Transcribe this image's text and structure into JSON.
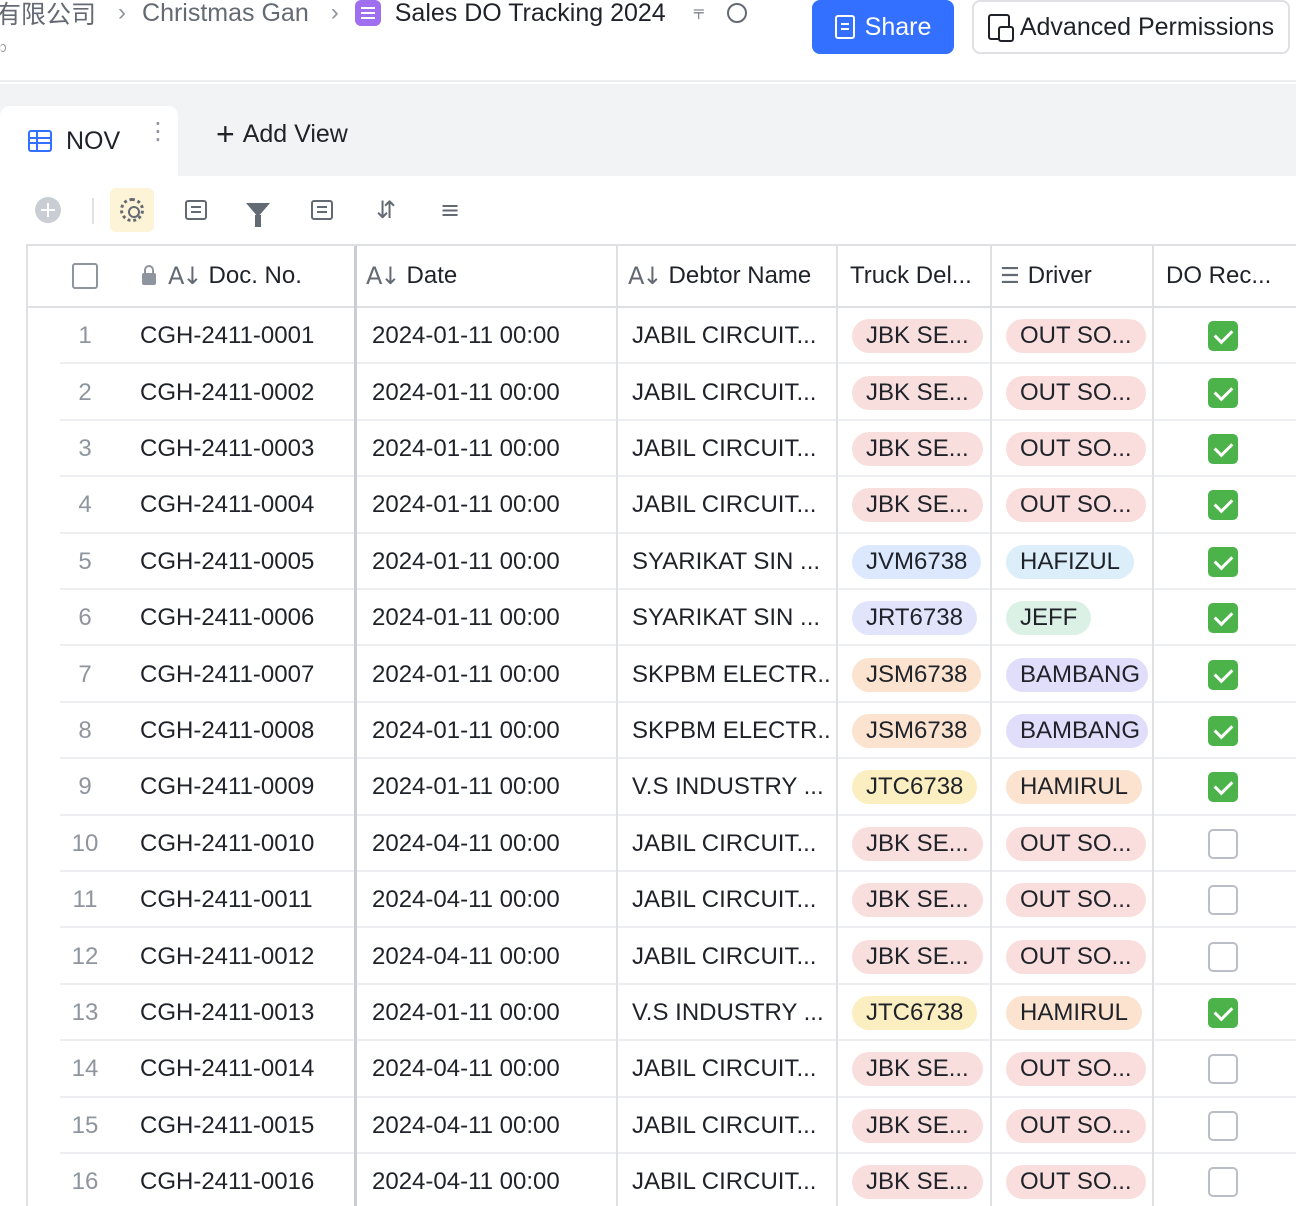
{
  "breadcrumb": {
    "org": "有限公司",
    "workspace": "Christmas Gan",
    "document": "Sales DO Tracking 2024"
  },
  "header": {
    "share_label": "Share",
    "permissions_label": "Advanced Permissions"
  },
  "tabs": {
    "active_label": "NOV",
    "add_view_label": "Add View"
  },
  "colors": {
    "accent": "#3370ff",
    "check_on": "#4cb24a",
    "tag_jbk": "#f9dede",
    "tag_out": "#fadede",
    "tag_blue": "#dbe8fd",
    "tag_green": "#dcf1e6",
    "tag_orange": "#fbe3d0",
    "tag_yellow": "#fbeec0",
    "tag_purple": "#e1defb",
    "tag_hamirul": "#fbe3d0"
  },
  "table": {
    "columns": {
      "doc_no": "Doc. No.",
      "date": "Date",
      "debtor": "Debtor Name",
      "truck": "Truck Del...",
      "driver": "Driver",
      "do_rec": "DO Rec..."
    },
    "rows": [
      {
        "n": "1",
        "doc": "CGH-2411-0001",
        "date": "2024-01-11 00:00",
        "debtor": "JABIL CIRCUIT...",
        "truck": "JBK SE...",
        "truck_color": "#f9dede",
        "driver": "OUT SO...",
        "driver_color": "#fadede",
        "checked": true
      },
      {
        "n": "2",
        "doc": "CGH-2411-0002",
        "date": "2024-01-11 00:00",
        "debtor": "JABIL CIRCUIT...",
        "truck": "JBK SE...",
        "truck_color": "#f9dede",
        "driver": "OUT SO...",
        "driver_color": "#fadede",
        "checked": true
      },
      {
        "n": "3",
        "doc": "CGH-2411-0003",
        "date": "2024-01-11 00:00",
        "debtor": "JABIL CIRCUIT...",
        "truck": "JBK SE...",
        "truck_color": "#f9dede",
        "driver": "OUT SO...",
        "driver_color": "#fadede",
        "checked": true
      },
      {
        "n": "4",
        "doc": "CGH-2411-0004",
        "date": "2024-01-11 00:00",
        "debtor": "JABIL CIRCUIT...",
        "truck": "JBK SE...",
        "truck_color": "#f9dede",
        "driver": "OUT SO...",
        "driver_color": "#fadede",
        "checked": true
      },
      {
        "n": "5",
        "doc": "CGH-2411-0005",
        "date": "2024-01-11 00:00",
        "debtor": "SYARIKAT SIN ...",
        "truck": "JVM6738",
        "truck_color": "#dbe8fd",
        "driver": "HAFIZUL",
        "driver_color": "#dbeefa",
        "checked": true
      },
      {
        "n": "6",
        "doc": "CGH-2411-0006",
        "date": "2024-01-11 00:00",
        "debtor": "SYARIKAT SIN ...",
        "truck": "JRT6738",
        "truck_color": "#e1e4fb",
        "driver": "JEFF",
        "driver_color": "#dcf1e6",
        "checked": true
      },
      {
        "n": "7",
        "doc": "CGH-2411-0007",
        "date": "2024-01-11 00:00",
        "debtor": "SKPBM ELECTR...",
        "truck": "JSM6738",
        "truck_color": "#fbe3d0",
        "driver": "BAMBANG",
        "driver_color": "#e1defb",
        "checked": true
      },
      {
        "n": "8",
        "doc": "CGH-2411-0008",
        "date": "2024-01-11 00:00",
        "debtor": "SKPBM ELECTR...",
        "truck": "JSM6738",
        "truck_color": "#fbe3d0",
        "driver": "BAMBANG",
        "driver_color": "#e1defb",
        "checked": true
      },
      {
        "n": "9",
        "doc": "CGH-2411-0009",
        "date": "2024-01-11 00:00",
        "debtor": "V.S INDUSTRY ...",
        "truck": "JTC6738",
        "truck_color": "#fbeec0",
        "driver": "HAMIRUL",
        "driver_color": "#fbe3d0",
        "checked": true
      },
      {
        "n": "10",
        "doc": "CGH-2411-0010",
        "date": "2024-04-11 00:00",
        "debtor": "JABIL CIRCUIT...",
        "truck": "JBK SE...",
        "truck_color": "#f9dede",
        "driver": "OUT SO...",
        "driver_color": "#fadede",
        "checked": false
      },
      {
        "n": "11",
        "doc": "CGH-2411-0011",
        "date": "2024-04-11 00:00",
        "debtor": "JABIL CIRCUIT...",
        "truck": "JBK SE...",
        "truck_color": "#f9dede",
        "driver": "OUT SO...",
        "driver_color": "#fadede",
        "checked": false
      },
      {
        "n": "12",
        "doc": "CGH-2411-0012",
        "date": "2024-04-11 00:00",
        "debtor": "JABIL CIRCUIT...",
        "truck": "JBK SE...",
        "truck_color": "#f9dede",
        "driver": "OUT SO...",
        "driver_color": "#fadede",
        "checked": false
      },
      {
        "n": "13",
        "doc": "CGH-2411-0013",
        "date": "2024-01-11 00:00",
        "debtor": "V.S INDUSTRY ...",
        "truck": "JTC6738",
        "truck_color": "#fbeec0",
        "driver": "HAMIRUL",
        "driver_color": "#fbe3d0",
        "checked": true
      },
      {
        "n": "14",
        "doc": "CGH-2411-0014",
        "date": "2024-04-11 00:00",
        "debtor": "JABIL CIRCUIT...",
        "truck": "JBK SE...",
        "truck_color": "#f9dede",
        "driver": "OUT SO...",
        "driver_color": "#fadede",
        "checked": false
      },
      {
        "n": "15",
        "doc": "CGH-2411-0015",
        "date": "2024-04-11 00:00",
        "debtor": "JABIL CIRCUIT...",
        "truck": "JBK SE...",
        "truck_color": "#f9dede",
        "driver": "OUT SO...",
        "driver_color": "#fadede",
        "checked": false
      },
      {
        "n": "16",
        "doc": "CGH-2411-0016",
        "date": "2024-04-11 00:00",
        "debtor": "JABIL CIRCUIT...",
        "truck": "JBK SE...",
        "truck_color": "#f9dede",
        "driver": "OUT SO...",
        "driver_color": "#fadede",
        "checked": false
      }
    ]
  }
}
